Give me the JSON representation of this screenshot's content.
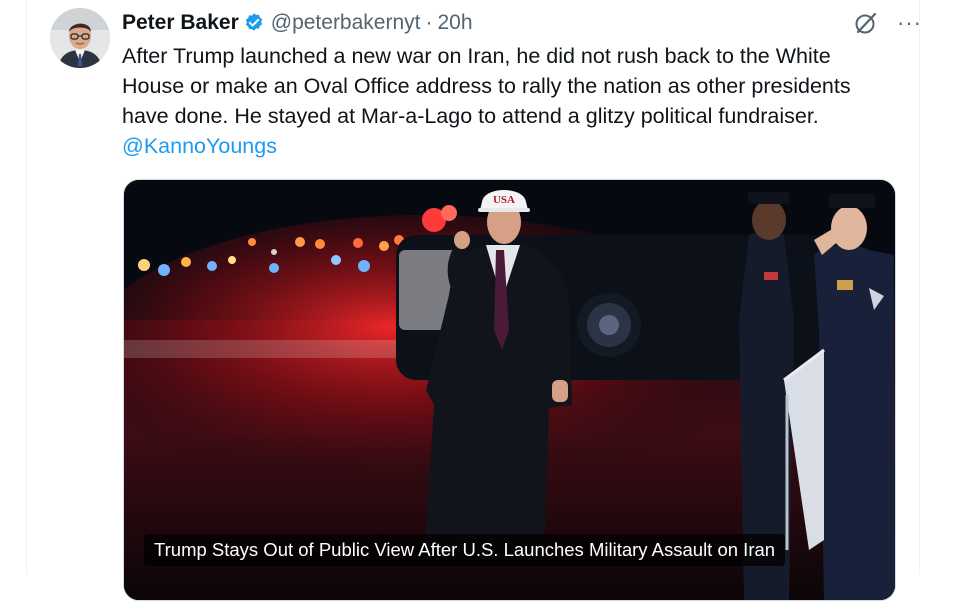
{
  "author": {
    "name": "Peter Baker",
    "handle": "@peterbakernyt",
    "separator": "·",
    "time": "20h",
    "verified": true,
    "avatar_icon": "avatar-photo"
  },
  "actions": {
    "grok_icon": "grok-slash-icon",
    "more_label": "···"
  },
  "tweet": {
    "text": "After Trump launched a new war on Iran, he did not rush back to the White House or make an Oval Office address to rally the nation as other presidents have done. He stayed at Mar-a-Lago to attend a glitzy political fundraiser.",
    "mention": "@KannoYoungs"
  },
  "media": {
    "cap_text": "USA",
    "caption": "Trump Stays Out of Public View After U.S. Launches Military Assault on Iran"
  },
  "colors": {
    "link": "#1d9bf0",
    "verified": "#1d9bf0",
    "secondary_text": "#536471"
  }
}
